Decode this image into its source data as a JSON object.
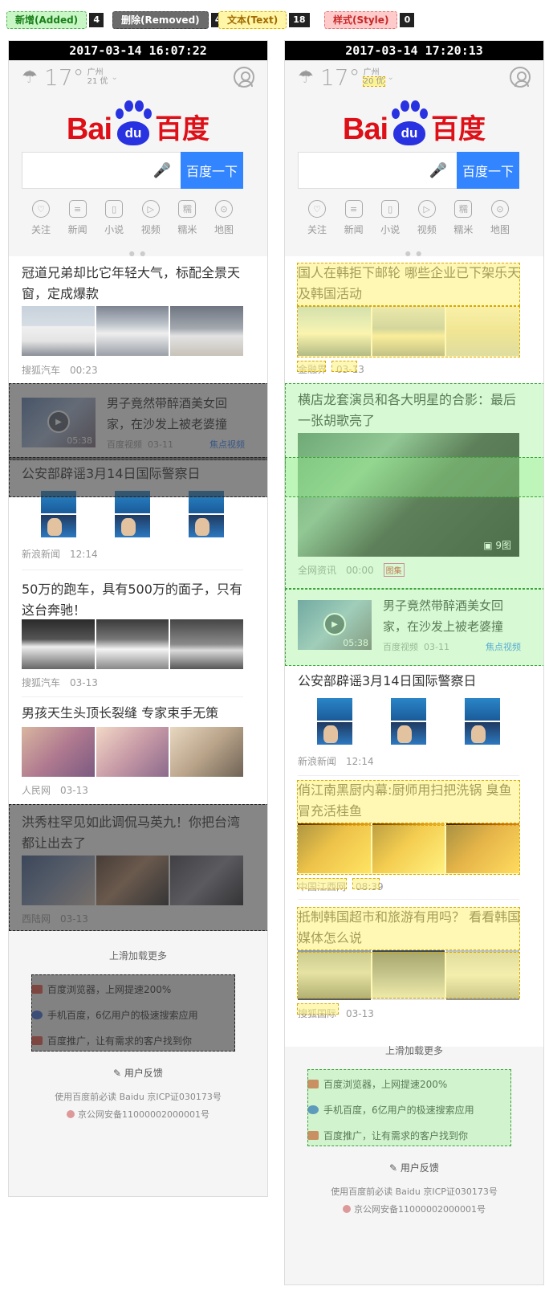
{
  "legend": [
    {
      "label": "新增(Added)",
      "count": "4"
    },
    {
      "label": "删除(Removed)",
      "count": "4"
    },
    {
      "label": "文本(Text)",
      "count": "18"
    },
    {
      "label": "样式(Style)",
      "count": "0"
    }
  ],
  "left": {
    "timestamp": "2017-03-14 16:07:22",
    "weather": {
      "temp": "17°",
      "city": "广州",
      "aqi": "21 优"
    },
    "search": {
      "button": "百度一下"
    },
    "nav": [
      "关注",
      "新闻",
      "小说",
      "视频",
      "糯米",
      "地图"
    ],
    "cards": [
      {
        "title": "冠道兄弟却比它年轻大气，标配全景天窗，定成爆款",
        "source": "搜狐汽车",
        "time": "00:23"
      },
      {
        "title": "男子竟然带醉酒美女回家，在沙发上被老婆撞",
        "source": "百度视频",
        "time": "03-11",
        "tag": "焦点视频",
        "duration": "05:38"
      },
      {
        "title": "公安部辟谣3月14日国际警察日",
        "source": "新浪新闻",
        "time": "12:14"
      },
      {
        "title": "50万的跑车，具有500万的面子，只有这台奔驰！",
        "source": "搜狐汽车",
        "time": "03-13"
      },
      {
        "title": "男孩天生头顶长裂缝 专家束手无策",
        "source": "人民网",
        "time": "03-13"
      },
      {
        "title": "洪秀柱罕见如此调侃马英九！你把台湾都让出去了",
        "source": "西陆网",
        "time": "03-13"
      }
    ],
    "more": "上滑加载更多",
    "promo": [
      "百度浏览器，上网提速200%",
      "手机百度，6亿用户的极速搜索应用",
      "百度推广，让有需求的客户找到你"
    ],
    "feedback": "用户反馈",
    "footer1": "使用百度前必读 Baidu 京ICP证030173号",
    "footer2": "京公网安备11000002000001号"
  },
  "right": {
    "timestamp": "2017-03-14 17:20:13",
    "weather": {
      "temp": "17°",
      "city": "广州",
      "aqi": "20 优"
    },
    "search": {
      "button": "百度一下"
    },
    "nav": [
      "关注",
      "新闻",
      "小说",
      "视频",
      "糯米",
      "地图"
    ],
    "cards": [
      {
        "title": "国人在韩拒下邮轮 哪些企业已下架乐天及韩国活动",
        "source": "金融界",
        "time": "03-13"
      },
      {
        "title": "横店龙套演员和各大明星的合影：最后一张胡歌亮了",
        "source": "全网资讯",
        "time": "00:00",
        "badge": "图集",
        "count": "9图"
      },
      {
        "title": "男子竟然带醉酒美女回家，在沙发上被老婆撞",
        "source": "百度视频",
        "time": "03-11",
        "tag": "焦点视频",
        "duration": "05:38"
      },
      {
        "title": "公安部辟谣3月14日国际警察日",
        "source": "新浪新闻",
        "time": "12:14"
      },
      {
        "title": "俏江南黑厨内幕:厨师用扫把洗锅 臭鱼冒充活桂鱼",
        "source": "中国江西网",
        "time": "08:39"
      },
      {
        "title": "抵制韩国超市和旅游有用吗？ 看看韩国媒体怎么说",
        "source": "搜狐国际",
        "time": "03-13"
      }
    ],
    "more": "上滑加载更多",
    "promo": [
      "百度浏览器，上网提速200%",
      "手机百度，6亿用户的极速搜索应用",
      "百度推广，让有需求的客户找到你"
    ],
    "feedback": "用户反馈",
    "footer1": "使用百度前必读 Baidu 京ICP证030173号",
    "footer2": "京公网安备11000002000001号"
  }
}
